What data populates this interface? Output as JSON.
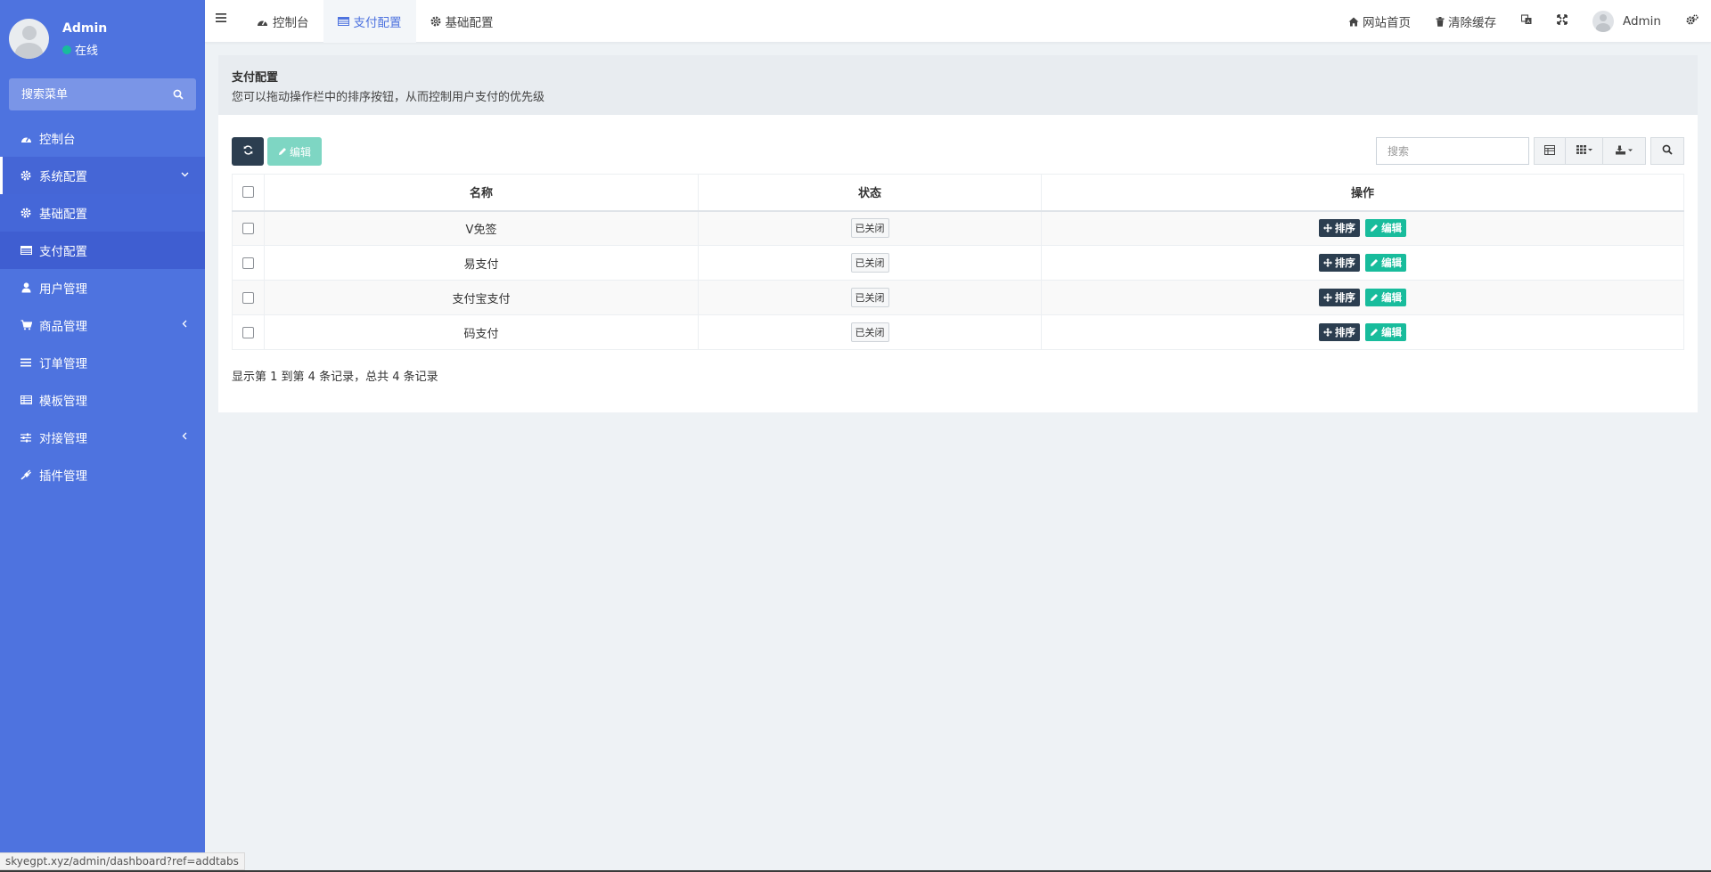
{
  "colors": {
    "sidebar": "#4e73df",
    "accent": "#4e73df",
    "dark": "#2c3e50",
    "success": "#18bc9c"
  },
  "sidebar": {
    "user": {
      "name": "Admin",
      "status": "在线"
    },
    "search_placeholder": "搜索菜单",
    "menu": [
      {
        "label": "控制台",
        "icon": "dashboard-icon"
      },
      {
        "label": "系统配置",
        "icon": "gear-icon",
        "expanded": true,
        "children": [
          {
            "label": "基础配置",
            "icon": "gear-icon"
          },
          {
            "label": "支付配置",
            "icon": "table-icon",
            "active": true
          }
        ]
      },
      {
        "label": "用户管理",
        "icon": "user-icon"
      },
      {
        "label": "商品管理",
        "icon": "cart-icon"
      },
      {
        "label": "订单管理",
        "icon": "list-icon"
      },
      {
        "label": "模板管理",
        "icon": "template-icon"
      },
      {
        "label": "对接管理",
        "icon": "sliders-icon"
      },
      {
        "label": "插件管理",
        "icon": "plug-icon"
      }
    ]
  },
  "header": {
    "tabs": [
      {
        "label": "控制台",
        "icon": "dashboard-icon"
      },
      {
        "label": "支付配置",
        "icon": "table-icon",
        "active": true
      },
      {
        "label": "基础配置",
        "icon": "gear-icon"
      }
    ],
    "right": {
      "home_label": "网站首页",
      "clear_cache_label": "清除缓存",
      "user_name": "Admin"
    }
  },
  "panel": {
    "title": "支付配置",
    "description": "您可以拖动操作栏中的排序按钮，从而控制用户支付的优先级",
    "edit_label": "编辑",
    "search_placeholder": "搜索",
    "columns": [
      "名称",
      "状态",
      "操作"
    ],
    "rows": [
      {
        "name": "V免签",
        "status": "已关闭"
      },
      {
        "name": "易支付",
        "status": "已关闭"
      },
      {
        "name": "支付宝支付",
        "status": "已关闭"
      },
      {
        "name": "码支付",
        "status": "已关闭"
      }
    ],
    "row_actions": {
      "sort_label": "排序",
      "edit_label": "编辑"
    },
    "pagination_info": "显示第 1 到第 4 条记录，总共 4 条记录"
  },
  "statusbar": {
    "url": "skyegpt.xyz/admin/dashboard?ref=addtabs"
  }
}
